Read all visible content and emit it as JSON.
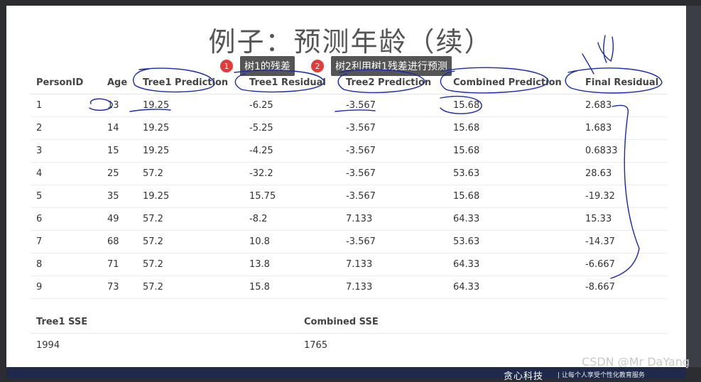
{
  "title": "例子：预测年龄（续）",
  "callouts": [
    {
      "number": "1",
      "text": "树1的残差"
    },
    {
      "number": "2",
      "text": "树2利用树1残差进行预测"
    }
  ],
  "table": {
    "headers": [
      "PersonID",
      "Age",
      "Tree1 Prediction",
      "Tree1 Residual",
      "Tree2 Prediction",
      "Combined Prediction",
      "Final Residual"
    ],
    "rows": [
      [
        "1",
        "13",
        "19.25",
        "-6.25",
        "-3.567",
        "15.68",
        "2.683"
      ],
      [
        "2",
        "14",
        "19.25",
        "-5.25",
        "-3.567",
        "15.68",
        "1.683"
      ],
      [
        "3",
        "15",
        "19.25",
        "-4.25",
        "-3.567",
        "15.68",
        "0.6833"
      ],
      [
        "4",
        "25",
        "57.2",
        "-32.2",
        "-3.567",
        "53.63",
        "28.63"
      ],
      [
        "5",
        "35",
        "19.25",
        "15.75",
        "-3.567",
        "15.68",
        "-19.32"
      ],
      [
        "6",
        "49",
        "57.2",
        "-8.2",
        "7.133",
        "64.33",
        "15.33"
      ],
      [
        "7",
        "68",
        "57.2",
        "10.8",
        "-3.567",
        "53.63",
        "-14.37"
      ],
      [
        "8",
        "71",
        "57.2",
        "13.8",
        "7.133",
        "64.33",
        "-6.667"
      ],
      [
        "9",
        "73",
        "57.2",
        "15.8",
        "7.133",
        "64.33",
        "-8.667"
      ]
    ]
  },
  "sse": {
    "headers": [
      "Tree1 SSE",
      "Combined SSE"
    ],
    "values": [
      "1994",
      "1765"
    ]
  },
  "footer": {
    "brand": "贪心科技",
    "slogan": "| 让每个人享受个性化教育服务"
  },
  "watermark": "CSDN @Mr DaYang"
}
